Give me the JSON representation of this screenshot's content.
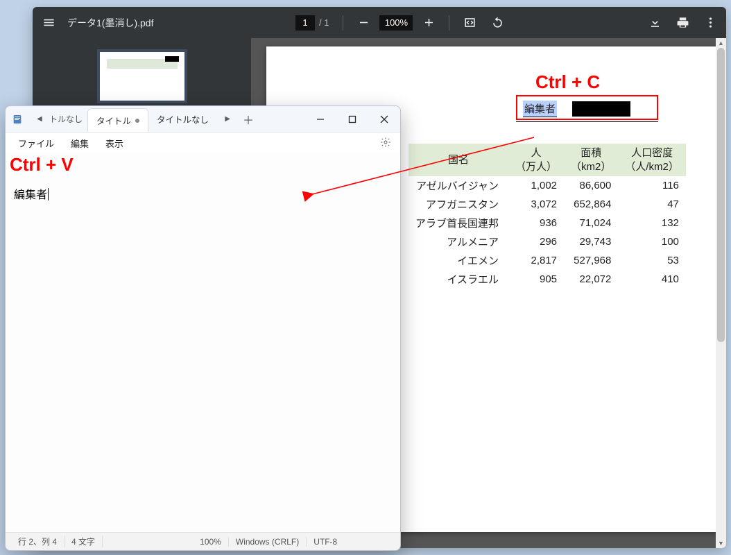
{
  "pdf": {
    "filename": "データ1(墨消し).pdf",
    "page_current": "1",
    "page_total": "/  1",
    "zoom": "100%",
    "copy_label": "Ctrl + C",
    "editor_field_label": "編集者",
    "table": {
      "headers": {
        "country": "国名",
        "pop": "人",
        "pop_sub": "（万人）",
        "area": "面積",
        "area_sub": "（km2）",
        "density": "人口密度",
        "density_sub": "（人/km2）"
      },
      "rows": [
        {
          "country": "アゼルバイジャン",
          "pop": "1,002",
          "area": "86,600",
          "density": "116"
        },
        {
          "country": "アフガニスタン",
          "pop": "3,072",
          "area": "652,864",
          "density": "47"
        },
        {
          "country": "アラブ首長国連邦",
          "pop": "936",
          "area": "71,024",
          "density": "132"
        },
        {
          "country": "アルメニア",
          "pop": "296",
          "area": "29,743",
          "density": "100"
        },
        {
          "country": "イエメン",
          "pop": "2,817",
          "area": "527,968",
          "density": "53"
        },
        {
          "country": "イスラエル",
          "pop": "905",
          "area": "22,072",
          "density": "410"
        }
      ]
    }
  },
  "editor": {
    "nav_prev_label": "トルなし",
    "active_tab": "タイトル",
    "inactive_tab": "タイトルなし",
    "menu": {
      "file": "ファイル",
      "edit": "編集",
      "view": "表示"
    },
    "paste_label": "Ctrl + V",
    "content_line": "編集者",
    "status": {
      "pos": "行 2、列 4",
      "chars": "4 文字",
      "zoom": "100%",
      "eol": "Windows (CRLF)",
      "encoding": "UTF-8"
    }
  }
}
